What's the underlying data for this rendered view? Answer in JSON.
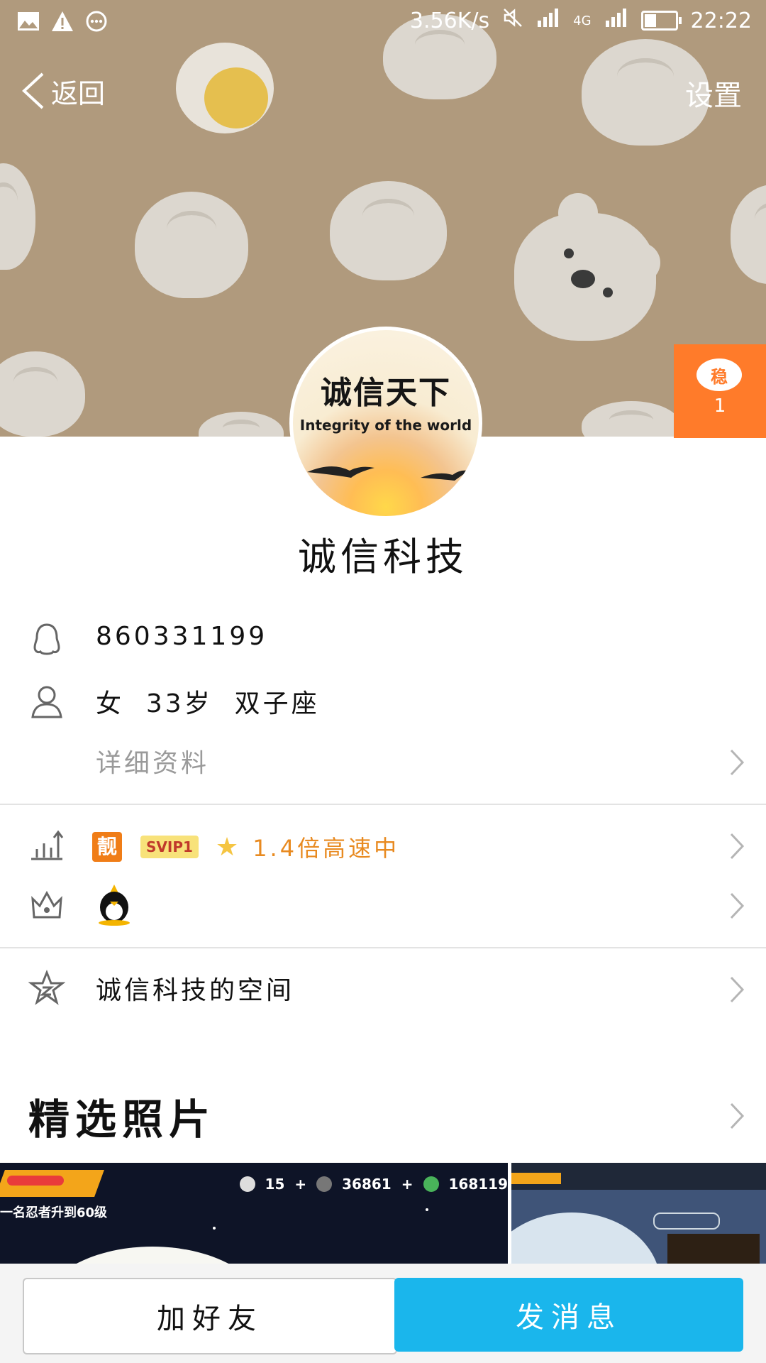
{
  "status_bar": {
    "network_speed": "3.56K/s",
    "network_type": "4G",
    "time": "22:22",
    "battery_level": 0.4
  },
  "nav": {
    "back_label": "返回",
    "settings_label": "设置"
  },
  "badge": {
    "icon_text": "稳",
    "count": "1"
  },
  "avatar": {
    "title_cn": "诚信天下",
    "title_en": "Integrity of the world"
  },
  "profile": {
    "name": "诚信科技",
    "qq_number": "860331199",
    "basic_info": "女  33岁  双子座",
    "details_link": "详细资料"
  },
  "vip": {
    "liang_badge": "靓",
    "svip_badge": "SVIP1",
    "speed_text": "1.4倍高速中"
  },
  "space": {
    "label": "诚信科技的空间"
  },
  "photos": {
    "title": "精选照片",
    "photo1": {
      "banner": "一名忍者升到60级",
      "stat1": "15",
      "stat2": "36861",
      "stat3": "168119"
    }
  },
  "actions": {
    "add_friend": "加好友",
    "send_message": "发消息"
  },
  "colors": {
    "header_bg": "#b09a7d",
    "badge_orange": "#ff7b2a",
    "primary_blue": "#1ab6ec",
    "vip_orange": "#e88a20"
  }
}
